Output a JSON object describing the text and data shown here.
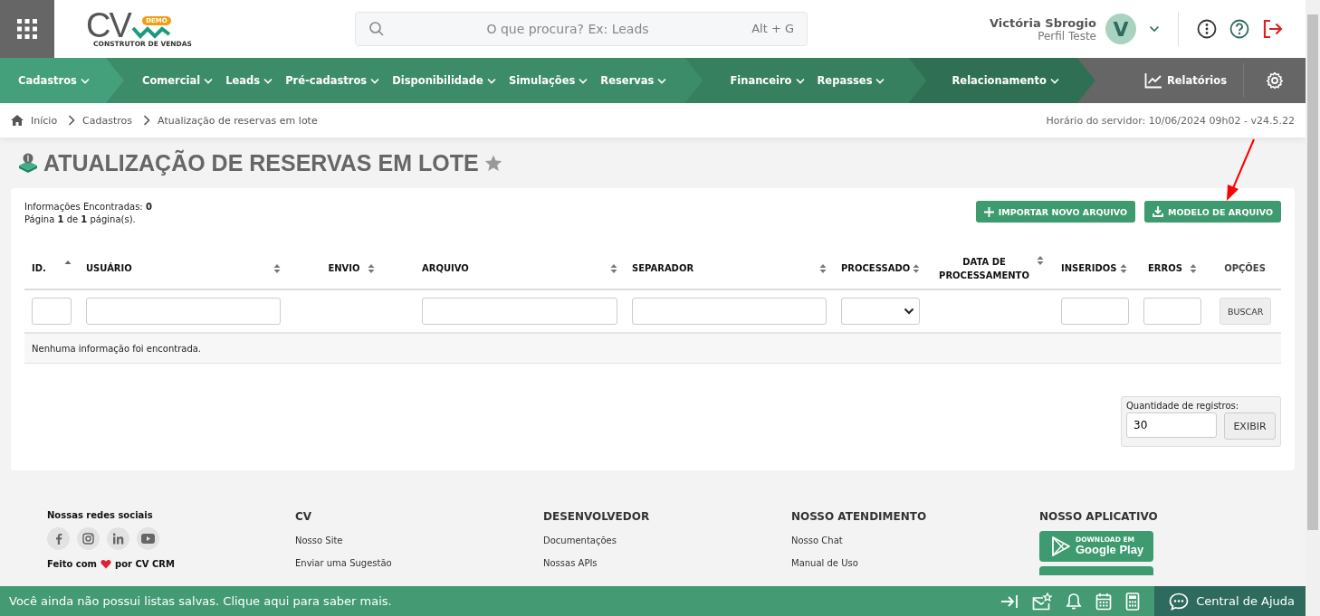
{
  "header": {
    "logo": {
      "mark": "CV",
      "badge": "DEMO",
      "tagline": "CONSTRUTOR DE VENDAS"
    },
    "search": {
      "placeholder": "O que procura? Ex: Leads",
      "shortcut": "Alt + G"
    },
    "user": {
      "name": "Victória Sbrogio",
      "profile": "Perfil Teste",
      "initial": "V"
    }
  },
  "nav": {
    "groups": [
      {
        "items": [
          {
            "label": "Cadastros",
            "selected": true
          }
        ]
      },
      {
        "items": [
          {
            "label": "Comercial",
            "selected": false
          },
          {
            "label": "Leads",
            "selected": false
          },
          {
            "label": "Pré-cadastros",
            "selected": false
          },
          {
            "label": "Disponibilidade",
            "selected": false
          },
          {
            "label": "Simulações",
            "selected": false
          },
          {
            "label": "Reservas",
            "selected": false
          }
        ]
      },
      {
        "items": [
          {
            "label": "Financeiro",
            "selected": false
          },
          {
            "label": "Repasses",
            "selected": false
          }
        ]
      },
      {
        "items": [
          {
            "label": "Relacionamento",
            "selected": false
          }
        ]
      }
    ],
    "reports": "Relatórios"
  },
  "breadcrumb": [
    "Início",
    "Cadastros",
    "Atualização de reservas em lote"
  ],
  "server_time": "Horário do servidor: 10/06/2024 09h02 - v24.5.22",
  "page": {
    "title": "ATUALIZAÇÃO DE RESERVAS EM LOTE",
    "favorite": false
  },
  "summary": {
    "found": "Informações Encontradas: **0**",
    "pages": "Página **1** de **1** página(s)."
  },
  "actions": [
    {
      "label": "IMPORTAR NOVO ARQUIVO",
      "kind": "plus"
    },
    {
      "label": "MODELO DE ARQUIVO",
      "kind": "download"
    }
  ],
  "table": {
    "columns": [
      {
        "label": "ID.",
        "sortable": true,
        "sorted": true,
        "kind": "input"
      },
      {
        "label": "USUÁRIO",
        "sortable": true,
        "sorted": false,
        "kind": "input"
      },
      {
        "label": "ENVIO",
        "sortable": true,
        "sorted": false,
        "kind": "empty"
      },
      {
        "label": "ARQUIVO",
        "sortable": true,
        "sorted": false,
        "kind": "input"
      },
      {
        "label": "SEPARADOR",
        "sortable": true,
        "sorted": false,
        "kind": "input"
      },
      {
        "label": "PROCESSADO",
        "sortable": true,
        "sorted": false,
        "kind": "select"
      },
      {
        "label": "DATA DE PROCESSAMENTO",
        "sortable": true,
        "sorted": false,
        "kind": "empty"
      },
      {
        "label": "INSERIDOS",
        "sortable": true,
        "sorted": false,
        "kind": "input"
      },
      {
        "label": "ERROS",
        "sortable": true,
        "sorted": false,
        "kind": "input"
      },
      {
        "label": "OPÇÕES",
        "sortable": false,
        "kind": "button"
      }
    ],
    "search_button": "BUSCAR",
    "empty_message": "Nenhuma informação foi encontrada."
  },
  "page_size": {
    "label": "Quantidade de registros:",
    "value": "30",
    "button": "EXIBIR"
  },
  "footer": {
    "social_title": "Nossas redes sociais",
    "made_with_before": "Feito com",
    "made_with_after": "por CV CRM",
    "columns": [
      {
        "title": "CV",
        "links": [
          "Nosso Site",
          "Enviar uma Sugestão"
        ]
      },
      {
        "title": "DESENVOLVEDOR",
        "links": [
          "Documentações",
          "Nossas APIs"
        ]
      },
      {
        "title": "NOSSO ATENDIMENTO",
        "links": [
          "Nosso Chat",
          "Manual de Uso"
        ]
      }
    ],
    "app": {
      "title": "NOSSO APLICATIVO",
      "small": "DOWNLOAD EM",
      "store": "Google Play"
    }
  },
  "bottom_bar": {
    "message": "Você ainda não possui listas salvas. Clique aqui para saber mais.",
    "help": "Central de Ajuda"
  }
}
